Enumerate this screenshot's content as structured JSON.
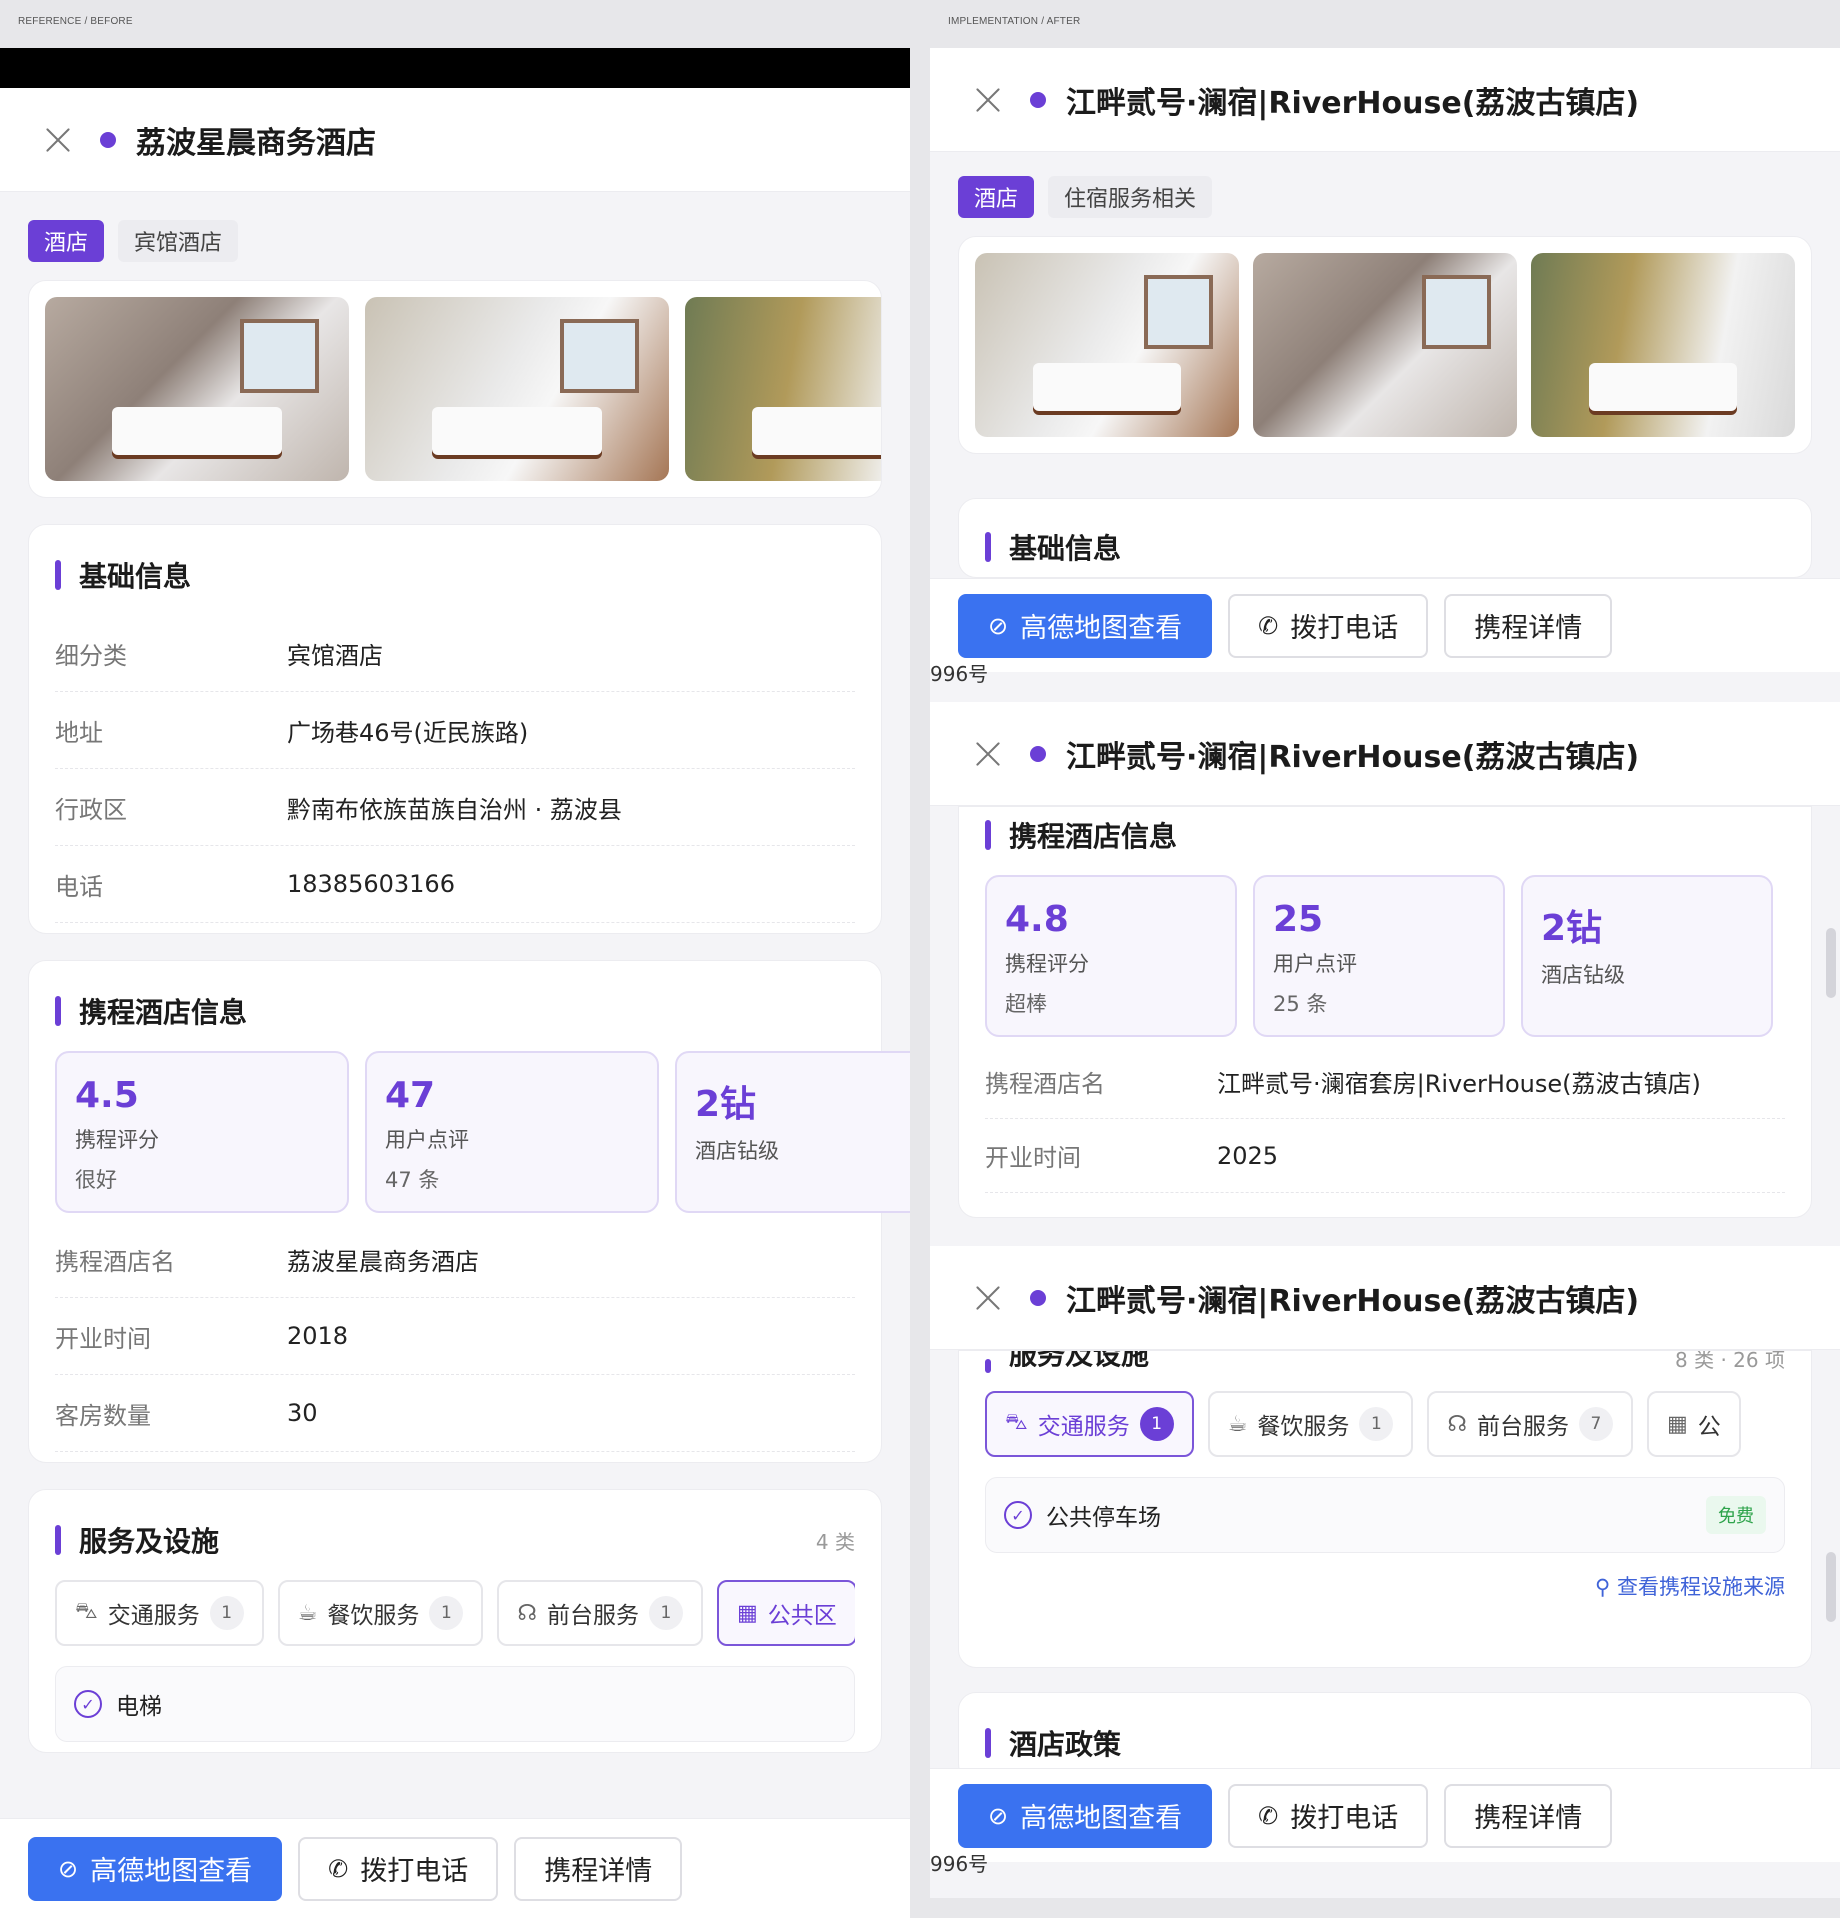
{
  "labels": {
    "before": "REFERENCE / BEFORE",
    "after": "IMPLEMENTATION / AFTER"
  },
  "accent": "#6b3fd6",
  "button_blue": "#3a72f0",
  "left": {
    "title": "荔波星晨商务酒店",
    "tags": [
      "酒店",
      "宾馆酒店"
    ],
    "basic": {
      "title": "基础信息",
      "rows": [
        {
          "k": "细分类",
          "v": "宾馆酒店"
        },
        {
          "k": "地址",
          "v": "广场巷46号(近民族路)"
        },
        {
          "k": "行政区",
          "v": "黔南布依族苗族自治州 · 荔波县"
        },
        {
          "k": "电话",
          "v": "18385603166"
        }
      ]
    },
    "ctrip": {
      "title": "携程酒店信息",
      "stats": [
        {
          "num": "4.5",
          "label": "携程评分",
          "sub": "很好"
        },
        {
          "num": "47",
          "label": "用户点评",
          "sub": "47 条"
        },
        {
          "num": "2钻",
          "label": "酒店钻级",
          "sub": ""
        }
      ],
      "rows": [
        {
          "k": "携程酒店名",
          "v": "荔波星晨商务酒店"
        },
        {
          "k": "开业时间",
          "v": "2018"
        },
        {
          "k": "客房数量",
          "v": "30"
        }
      ]
    },
    "services": {
      "title": "服务及设施",
      "count": "4 类",
      "chips": [
        {
          "icon": "bus-icon",
          "glyph": "⛍",
          "label": "交通服务",
          "badge": "1",
          "active": false
        },
        {
          "icon": "cup-icon",
          "glyph": "☕",
          "label": "餐饮服务",
          "badge": "1",
          "active": false
        },
        {
          "icon": "headset-icon",
          "glyph": "☊",
          "label": "前台服务",
          "badge": "1",
          "active": false
        },
        {
          "icon": "grid-icon",
          "glyph": "▦",
          "label": "公共区",
          "badge": "",
          "active": true
        }
      ],
      "facility": "电梯"
    },
    "buttons": {
      "map": "高德地图查看",
      "call": "拨打电话",
      "detail": "携程详情"
    }
  },
  "right": {
    "title": "江畔贰号·澜宿|RiverHouse(荔波古镇店)",
    "tags": [
      "酒店",
      "住宿服务相关"
    ],
    "basic_title": "基础信息",
    "peek_address": "996号",
    "ctrip": {
      "title": "携程酒店信息",
      "stats": [
        {
          "num": "4.8",
          "label": "携程评分",
          "sub": "超棒"
        },
        {
          "num": "25",
          "label": "用户点评",
          "sub": "25 条"
        },
        {
          "num": "2钻",
          "label": "酒店钻级",
          "sub": ""
        }
      ],
      "rows": [
        {
          "k": "携程酒店名",
          "v": "江畔贰号·澜宿套房|RiverHouse(荔波古镇店)"
        },
        {
          "k": "开业时间",
          "v": "2025"
        }
      ]
    },
    "services": {
      "title": "服务及设施",
      "count": "8 类 · 26 项",
      "chips": [
        {
          "icon": "bus-icon",
          "glyph": "⛍",
          "label": "交通服务",
          "badge": "1",
          "active": true
        },
        {
          "icon": "cup-icon",
          "glyph": "☕",
          "label": "餐饮服务",
          "badge": "1",
          "active": false
        },
        {
          "icon": "headset-icon",
          "glyph": "☊",
          "label": "前台服务",
          "badge": "7",
          "active": false
        },
        {
          "icon": "grid-icon",
          "glyph": "▦",
          "label": "公",
          "badge": "",
          "active": false
        }
      ],
      "facility": "公共停车场",
      "free": "免费",
      "source_link": "查看携程设施来源"
    },
    "policy_title": "酒店政策",
    "buttons": {
      "map": "高德地图查看",
      "call": "拨打电话",
      "detail": "携程详情"
    }
  }
}
